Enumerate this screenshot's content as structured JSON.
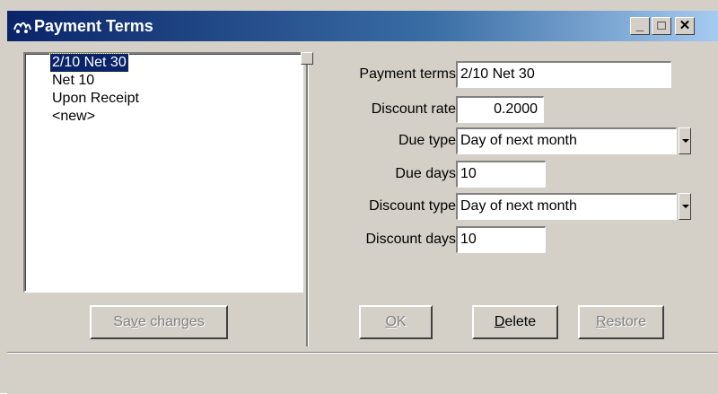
{
  "window": {
    "title": "Payment Terms",
    "minimize_label": "_",
    "maximize_label": "□",
    "close_label": "✕"
  },
  "list": {
    "items": [
      {
        "label": "2/10 Net 30",
        "selected": true
      },
      {
        "label": "Net 10",
        "selected": false
      },
      {
        "label": "Upon Receipt",
        "selected": false
      },
      {
        "label": "<new>",
        "selected": false
      }
    ]
  },
  "form": {
    "payment_terms": {
      "label": "Payment terms",
      "value": "2/10 Net 30"
    },
    "discount_rate": {
      "label": "Discount rate",
      "value": "0.2000"
    },
    "due_type": {
      "label": "Due type",
      "value": "Day of next month"
    },
    "due_days": {
      "label": "Due days",
      "value": "10"
    },
    "discount_type": {
      "label": "Discount type",
      "value": "Day of next month"
    },
    "discount_days": {
      "label": "Discount days",
      "value": "10"
    }
  },
  "buttons": {
    "save_changes": {
      "pre": "Sa",
      "mn": "v",
      "post": "e changes",
      "enabled": false
    },
    "ok": {
      "pre": "",
      "mn": "O",
      "post": "K",
      "enabled": false
    },
    "delete": {
      "pre": "",
      "mn": "D",
      "post": "elete",
      "enabled": true
    },
    "restore": {
      "pre": "",
      "mn": "R",
      "post": "estore",
      "enabled": false
    }
  },
  "colors": {
    "face": "#d4d0c8",
    "title_start": "#0a246a",
    "title_end": "#a6caf0",
    "selection": "#0a246a"
  }
}
